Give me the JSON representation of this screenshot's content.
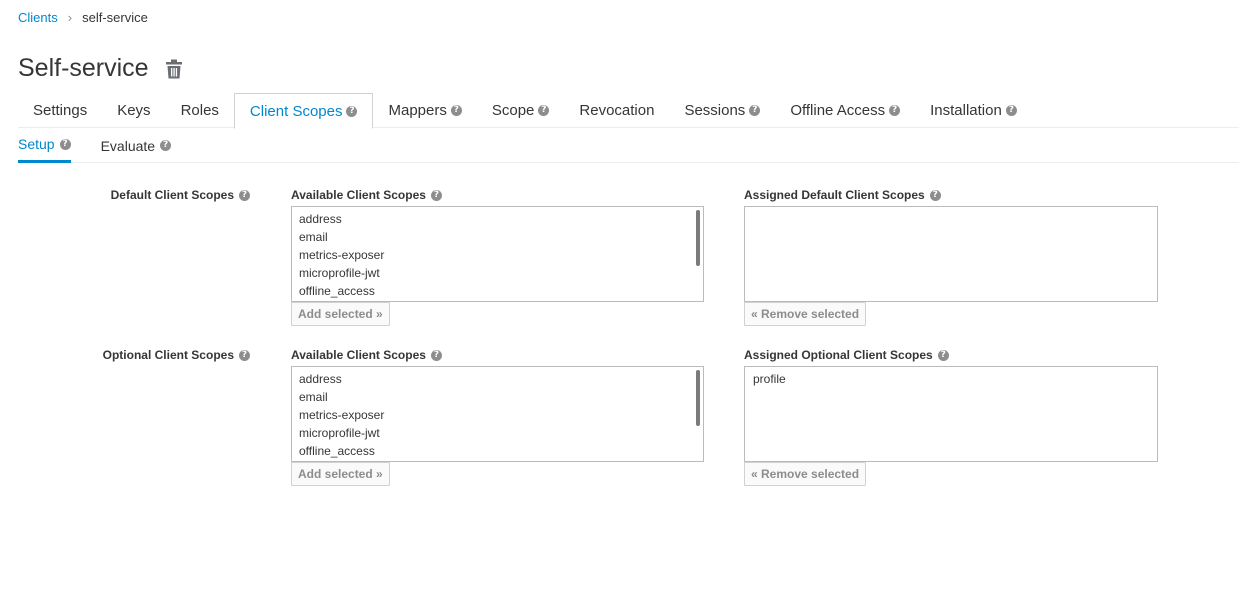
{
  "breadcrumb": {
    "parent": "Clients",
    "separator": "›",
    "current": "self-service"
  },
  "page": {
    "title": "Self-service",
    "delete_icon": "trash-icon"
  },
  "main_tabs": [
    {
      "label": "Settings",
      "help": false
    },
    {
      "label": "Keys",
      "help": false
    },
    {
      "label": "Roles",
      "help": false
    },
    {
      "label": "Client Scopes",
      "help": true,
      "active": true
    },
    {
      "label": "Mappers",
      "help": true
    },
    {
      "label": "Scope",
      "help": true
    },
    {
      "label": "Revocation",
      "help": false
    },
    {
      "label": "Sessions",
      "help": true
    },
    {
      "label": "Offline Access",
      "help": true
    },
    {
      "label": "Installation",
      "help": true
    }
  ],
  "sub_tabs": [
    {
      "label": "Setup",
      "active": true
    },
    {
      "label": "Evaluate",
      "active": false
    }
  ],
  "help_glyph": "?",
  "default_scopes": {
    "row_label": "Default Client Scopes",
    "available_label": "Available Client Scopes",
    "available": [
      "address",
      "email",
      "metrics-exposer",
      "microprofile-jwt",
      "offline_access"
    ],
    "assigned_label": "Assigned Default Client Scopes",
    "assigned": [],
    "add_button": "Add selected »",
    "remove_button": "« Remove selected"
  },
  "optional_scopes": {
    "row_label": "Optional Client Scopes",
    "available_label": "Available Client Scopes",
    "available": [
      "address",
      "email",
      "metrics-exposer",
      "microprofile-jwt",
      "offline_access"
    ],
    "assigned_label": "Assigned Optional Client Scopes",
    "assigned": [
      "profile"
    ],
    "add_button": "Add selected »",
    "remove_button": "« Remove selected"
  },
  "colors": {
    "link": "#0088ce",
    "text": "#363636",
    "muted": "#8b8d8f",
    "border": "#bbbbbb"
  }
}
